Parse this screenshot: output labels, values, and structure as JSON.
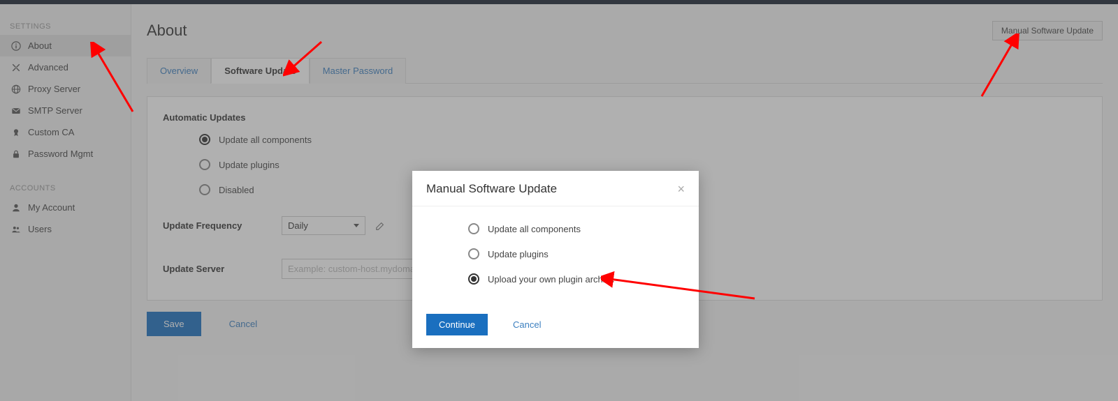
{
  "sidebar": {
    "group1_label": "SETTINGS",
    "group2_label": "ACCOUNTS",
    "items": [
      {
        "label": "About",
        "icon": "info"
      },
      {
        "label": "Advanced",
        "icon": "tools"
      },
      {
        "label": "Proxy Server",
        "icon": "globe"
      },
      {
        "label": "SMTP Server",
        "icon": "mail"
      },
      {
        "label": "Custom CA",
        "icon": "badge"
      },
      {
        "label": "Password Mgmt",
        "icon": "lock"
      }
    ],
    "accounts": [
      {
        "label": "My Account",
        "icon": "user"
      },
      {
        "label": "Users",
        "icon": "users"
      }
    ]
  },
  "header": {
    "title": "About",
    "manual_update_btn": "Manual Software Update"
  },
  "tabs": {
    "overview": "Overview",
    "software_update": "Software Update",
    "master_password": "Master Password"
  },
  "form": {
    "auto_label": "Automatic Updates",
    "opt_all": "Update all components",
    "opt_plugins": "Update plugins",
    "opt_disabled": "Disabled",
    "freq_label": "Update Frequency",
    "freq_value": "Daily",
    "server_label": "Update Server",
    "server_placeholder": "Example: custom-host.mydomain.com"
  },
  "actions": {
    "save": "Save",
    "cancel": "Cancel"
  },
  "modal": {
    "title": "Manual Software Update",
    "opt_all": "Update all components",
    "opt_plugins": "Update plugins",
    "opt_upload": "Upload your own plugin archive",
    "continue": "Continue",
    "cancel": "Cancel"
  }
}
